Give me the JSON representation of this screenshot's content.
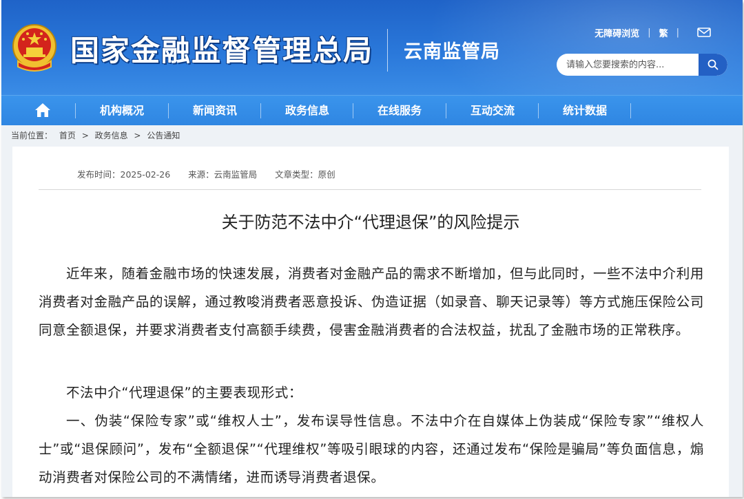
{
  "header": {
    "site_title": "国家金融监督管理总局",
    "branch_title": "云南监管局",
    "accessibility_link": "无障碍浏览",
    "traditional_link": "繁",
    "mail_icon": "mail-icon",
    "emblem_icon": "national-emblem-icon",
    "search": {
      "placeholder": "请输入您要搜索的内容...",
      "value": ""
    },
    "search_icon": "search-icon"
  },
  "nav": {
    "home_icon": "home-icon",
    "items": [
      {
        "label": "机构概况"
      },
      {
        "label": "新闻资讯"
      },
      {
        "label": "政务信息"
      },
      {
        "label": "在线服务"
      },
      {
        "label": "互动交流"
      },
      {
        "label": "统计数据"
      }
    ]
  },
  "breadcrumb": {
    "prefix": "当前位置：",
    "items": [
      "首页",
      "政务信息",
      "公告通知"
    ],
    "separator": ">"
  },
  "article": {
    "publish_time": "发布时间：2025-02-26",
    "source": "来源：云南监管局",
    "type": "文章类型：原创",
    "title": "关于防范不法中介“代理退保”的风险提示",
    "paragraphs": [
      "近年来，随着金融市场的快速发展，消费者对金融产品的需求不断增加，但与此同时，一些不法中介利用消费者对金融产品的误解，通过教唆消费者恶意投诉、伪造证据（如录音、聊天记录等）等方式施压保险公司同意全额退保，并要求消费者支付高额手续费，侵害金融消费者的合法权益，扰乱了金融市场的正常秩序。",
      "不法中介“代理退保”的主要表现形式：",
      "一、伪装“保险专家”或“维权人士”，发布误导性信息。不法中介在自媒体上伪装成“保险专家”“维权人士”或“退保顾问”，发布“全额退保”“代理维权”等吸引眼球的内容，还通过发布“保险是骗局”等负面信息，煽动消费者对保险公司的不满情绪，进而诱导消费者退保。"
    ]
  },
  "colors": {
    "header_blue": "#2a78da",
    "nav_blue": "#3a94ec",
    "page_bg": "#eef2f6"
  }
}
